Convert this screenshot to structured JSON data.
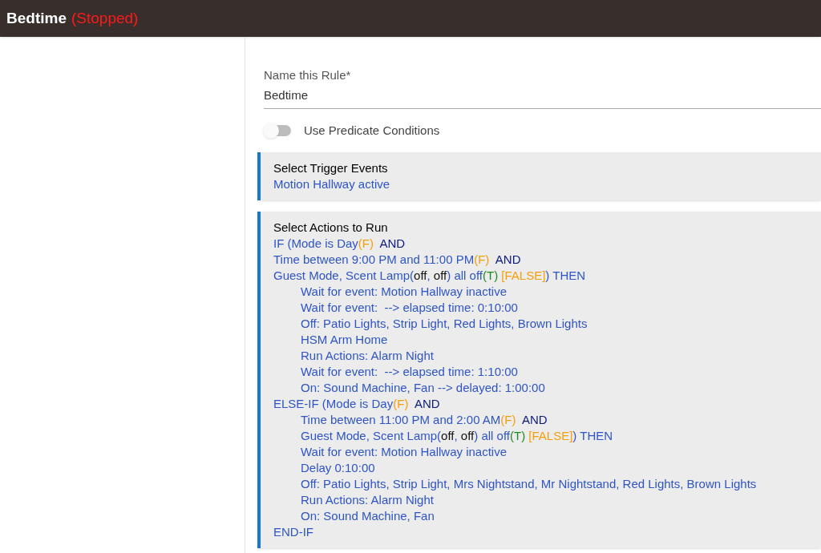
{
  "header": {
    "title": "Bedtime",
    "status": "(Stopped)"
  },
  "name_field": {
    "label": "Name this Rule*",
    "value": "Bedtime"
  },
  "predicate_toggle": {
    "label": "Use Predicate Conditions",
    "on": false
  },
  "trigger": {
    "title": "Select Trigger Events",
    "lines": [
      "Motion Hallway active"
    ]
  },
  "actions": {
    "title": "Select Actions to Run",
    "lines": [
      {
        "segments": [
          {
            "kind": "plain",
            "text": "IF (Mode is Day"
          },
          {
            "kind": "warn",
            "text": "(F)"
          },
          {
            "kind": "op",
            "text": "  AND"
          }
        ]
      },
      {
        "segments": [
          {
            "kind": "plain",
            "text": "Time between 9:00 PM and 11:00 PM"
          },
          {
            "kind": "warn",
            "text": "(F)"
          },
          {
            "kind": "op",
            "text": "  AND"
          }
        ]
      },
      {
        "segments": [
          {
            "kind": "plain",
            "text": "Guest Mode, Scent Lamp("
          },
          {
            "kind": "dark",
            "text": "off"
          },
          {
            "kind": "plain",
            "text": ", "
          },
          {
            "kind": "dark",
            "text": "off"
          },
          {
            "kind": "plain",
            "text": ") all off"
          },
          {
            "kind": "ok",
            "text": "(T)"
          },
          {
            "kind": "warn",
            "text": " [FALSE]"
          },
          {
            "kind": "plain",
            "text": ") THEN"
          }
        ],
        "children": [
          {
            "segments": [
              {
                "kind": "plain",
                "text": "Wait for event: Motion Hallway inactive"
              }
            ]
          },
          {
            "segments": [
              {
                "kind": "plain",
                "text": "Wait for event:  --> elapsed time: 0:10:00"
              }
            ]
          },
          {
            "segments": [
              {
                "kind": "plain",
                "text": "Off: Patio Lights, Strip Light, Red Lights, Brown Lights"
              }
            ]
          },
          {
            "segments": [
              {
                "kind": "plain",
                "text": "HSM Arm Home"
              }
            ]
          },
          {
            "segments": [
              {
                "kind": "plain",
                "text": "Run Actions: Alarm Night"
              }
            ]
          },
          {
            "segments": [
              {
                "kind": "plain",
                "text": "Wait for event:  --> elapsed time: 1:10:00"
              }
            ]
          },
          {
            "segments": [
              {
                "kind": "plain",
                "text": "On: Sound Machine, Fan --> delayed: 1:00:00"
              }
            ]
          }
        ]
      },
      {
        "segments": [
          {
            "kind": "plain",
            "text": "ELSE-IF (Mode is Day"
          },
          {
            "kind": "warn",
            "text": "(F)"
          },
          {
            "kind": "op",
            "text": "  AND"
          }
        ],
        "children": [
          {
            "segments": [
              {
                "kind": "plain",
                "text": "Time between 11:00 PM and 2:00 AM"
              },
              {
                "kind": "warn",
                "text": "(F)"
              },
              {
                "kind": "op",
                "text": "  AND"
              }
            ]
          },
          {
            "segments": [
              {
                "kind": "plain",
                "text": "Guest Mode, Scent Lamp("
              },
              {
                "kind": "dark",
                "text": "off"
              },
              {
                "kind": "plain",
                "text": ", "
              },
              {
                "kind": "dark",
                "text": "off"
              },
              {
                "kind": "plain",
                "text": ") all off"
              },
              {
                "kind": "ok",
                "text": "(T)"
              },
              {
                "kind": "warn",
                "text": " [FALSE]"
              },
              {
                "kind": "plain",
                "text": ") THEN"
              }
            ]
          },
          {
            "segments": [
              {
                "kind": "plain",
                "text": "Wait for event: Motion Hallway inactive"
              }
            ]
          },
          {
            "segments": [
              {
                "kind": "plain",
                "text": "Delay 0:10:00"
              }
            ]
          },
          {
            "segments": [
              {
                "kind": "plain",
                "text": "Off: Patio Lights, Strip Light, Mrs Nightstand, Mr Nightstand, Red Lights, Brown Lights"
              }
            ]
          },
          {
            "segments": [
              {
                "kind": "plain",
                "text": "Run Actions: Alarm Night"
              }
            ]
          },
          {
            "segments": [
              {
                "kind": "plain",
                "text": "On: Sound Machine, Fan"
              }
            ]
          }
        ]
      },
      {
        "segments": [
          {
            "kind": "plain",
            "text": "END-IF"
          }
        ]
      }
    ]
  }
}
